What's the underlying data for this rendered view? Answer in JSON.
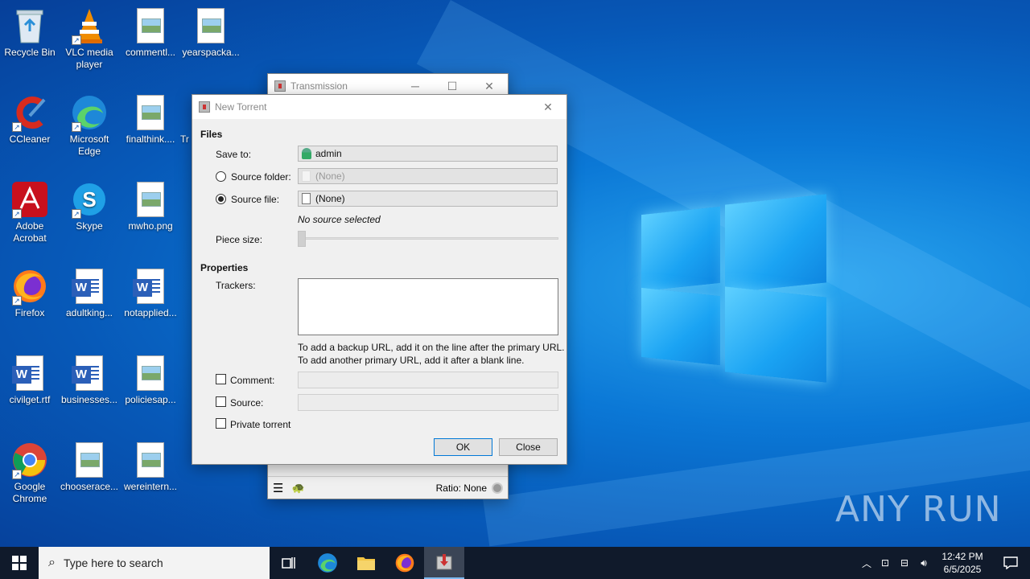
{
  "desktop_icons": [
    {
      "label": "Recycle Bin"
    },
    {
      "label": "VLC media player"
    },
    {
      "label": "commentl..."
    },
    {
      "label": "yearspacka..."
    },
    {
      "label": "CCleaner"
    },
    {
      "label": "Microsoft Edge"
    },
    {
      "label": "finalthink...."
    },
    {
      "label": "Tr"
    },
    {
      "label": "Adobe Acrobat"
    },
    {
      "label": "Skype"
    },
    {
      "label": "mwho.png"
    },
    {
      "label": "Firefox"
    },
    {
      "label": "adultking..."
    },
    {
      "label": "notapplied..."
    },
    {
      "label": "civilget.rtf"
    },
    {
      "label": "businesses..."
    },
    {
      "label": "policiesap..."
    },
    {
      "label": "Google Chrome"
    },
    {
      "label": "chooserace..."
    },
    {
      "label": "wereintern..."
    }
  ],
  "main_window": {
    "title": "Transmission",
    "ratio": "Ratio: None"
  },
  "dialog": {
    "title": "New Torrent",
    "files_heading": "Files",
    "save_to_label": "Save to:",
    "save_to_value": "admin",
    "source_folder_label": "Source folder:",
    "source_folder_value": "(None)",
    "source_file_label": "Source file:",
    "source_file_value": "(None)",
    "no_source": "No source selected",
    "piece_size_label": "Piece size:",
    "properties_heading": "Properties",
    "trackers_label": "Trackers:",
    "trackers_value": "",
    "hint_line1": "To add a backup URL, add it on the line after the primary URL.",
    "hint_line2": "To add another primary URL, add it after a blank line.",
    "comment_label": "Comment:",
    "source_label": "Source:",
    "private_label": "Private torrent",
    "ok_label": "OK",
    "close_label": "Close"
  },
  "taskbar": {
    "search_placeholder": "Type here to search",
    "time": "12:42 PM",
    "date": "6/5/2025"
  },
  "watermark": "ANY RUN"
}
